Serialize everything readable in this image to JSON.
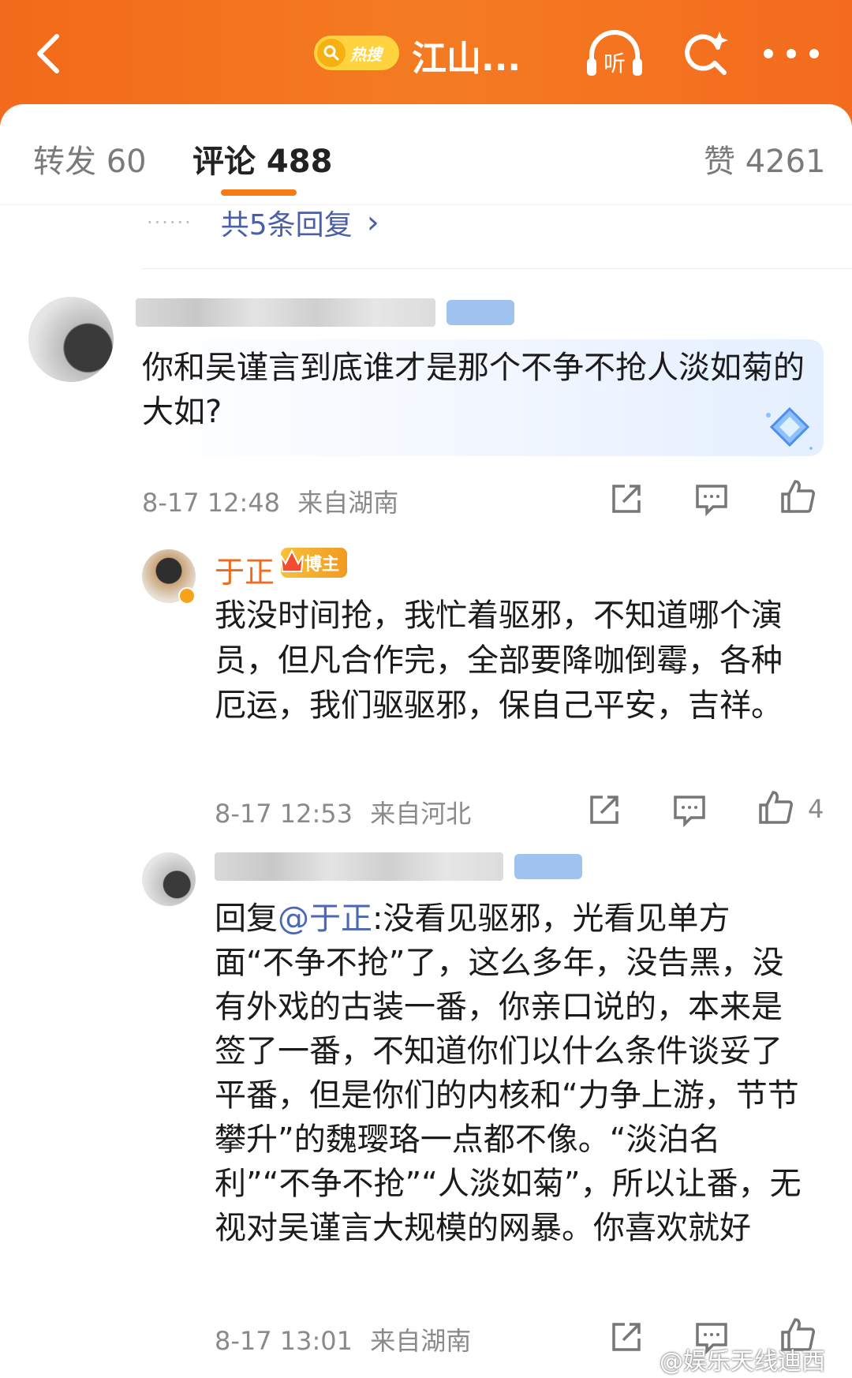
{
  "header": {
    "hot_label": "热搜",
    "title": "江山...",
    "listen_label": "听"
  },
  "tabs": [
    {
      "label": "转发 60"
    },
    {
      "label": "评论 488"
    },
    {
      "label": "赞 4261"
    }
  ],
  "more_replies": {
    "dots": "······",
    "label": "共5条回复",
    "chevron": "›"
  },
  "comments": [
    {
      "text": "你和吴谨言到底谁才是那个不争不抢人淡如菊的大如?",
      "time": "8-17 12:48",
      "location": "来自湖南"
    },
    {
      "username": "于正",
      "badge": "博主",
      "text": "我没时间抢，我忙着驱邪，不知道哪个演员，但凡合作完，全部要降咖倒霉，各种厄运，我们驱驱邪，保自己平安，吉祥。",
      "time": "8-17 12:53",
      "location": "来自河北",
      "likes": "4"
    },
    {
      "reply_prefix": "回复",
      "mention": "@于正",
      "text": ":没看见驱邪，光看见单方面“不争不抢”了，这么多年，没告黑，没有外戏的古装一番，你亲口说的，本来是签了一番，不知道你们以什么条件谈妥了平番，但是你们的内核和“力争上游，节节攀升”的魏璎珞一点都不像。“淡泊名利”“不争不抢”“人淡如菊”，所以让番，无视对吴谨言大规模的网暴。你喜欢就好",
      "time": "8-17 13:01",
      "location": "来自湖南"
    }
  ],
  "watermark": "@娱乐天线迪西",
  "colors": {
    "header_orange": "#f47b22",
    "accent": "#f77b14",
    "link_blue": "#4a5fa8",
    "username_orange": "#f26a1b"
  },
  "icons": [
    "back-icon",
    "search-icon",
    "listen-icon",
    "search-sparkle-icon",
    "more-icon",
    "share-icon",
    "comment-icon",
    "like-icon",
    "diamond-icon",
    "crown-icon"
  ]
}
